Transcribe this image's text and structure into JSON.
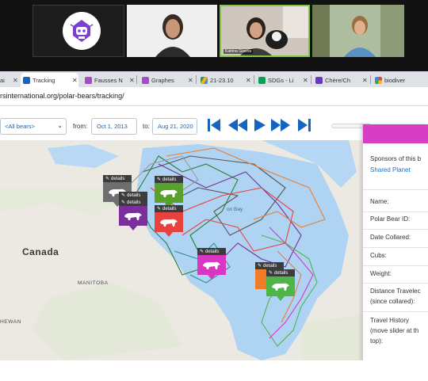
{
  "video_call": {
    "participants": [
      {
        "id": "p1",
        "type": "avatar",
        "icon": "robot-badge-icon"
      },
      {
        "id": "p2",
        "type": "camera"
      },
      {
        "id": "p3",
        "type": "camera",
        "name_tag": "Katrina Gaviria"
      },
      {
        "id": "p4",
        "type": "camera"
      }
    ]
  },
  "browser": {
    "tabs": [
      {
        "label": "ai",
        "icon": "page-icon",
        "active": false
      },
      {
        "label": "Tracking",
        "icon": "polar-bear-icon",
        "active": true
      },
      {
        "label": "Fausses N",
        "icon": "puzzle-icon",
        "active": false
      },
      {
        "label": "Graphes",
        "icon": "puzzle-icon",
        "active": false
      },
      {
        "label": "21-23.10",
        "icon": "drive-icon",
        "active": false
      },
      {
        "label": "SDGs - Li",
        "icon": "sheets-icon",
        "active": false
      },
      {
        "label": "Chère/Ch",
        "icon": "forms-icon",
        "active": false
      },
      {
        "label": "biodiver",
        "icon": "google-icon",
        "active": false
      }
    ],
    "url": "rsinternational.org/polar-bears/tracking/"
  },
  "toolbar": {
    "bear_select": "<All bears>",
    "from_label": "from:",
    "from_date": "Oct 1, 2013",
    "to_label": "to:",
    "to_date": "Aug 21, 2020"
  },
  "map": {
    "labels": {
      "canada": "Canada",
      "manitoba": "MANITOBA",
      "sask": "HEWAN",
      "bay": "on Bay"
    },
    "markers": [
      {
        "label": "details",
        "color": "#6e6e6e"
      },
      {
        "label": "details",
        "color": "#59a12c"
      },
      {
        "label": "details",
        "color": "#6e6e6e"
      },
      {
        "label": "details",
        "color": "#7a2f9a"
      },
      {
        "label": "details",
        "color": "#e8413e"
      },
      {
        "label": "details",
        "color": "#d936c2"
      },
      {
        "label": "details",
        "color": "#f07c2a"
      },
      {
        "label": "details",
        "color": "#4fb548"
      }
    ]
  },
  "panel": {
    "header_color": "#d63fc4",
    "sponsors_text": "Sponsors of this b",
    "sponsor_link": "Shared Planet",
    "fields": [
      {
        "label": "Name:"
      },
      {
        "label": "Polar Bear ID:"
      },
      {
        "label": "Date Collared:"
      },
      {
        "label": "Cubs:"
      },
      {
        "label": "Weight:"
      },
      {
        "label": "Distance Travelec",
        "label2": "(since collared):"
      },
      {
        "label": "Travel History",
        "label2": "(move slider at th",
        "label3": "top):"
      }
    ]
  }
}
